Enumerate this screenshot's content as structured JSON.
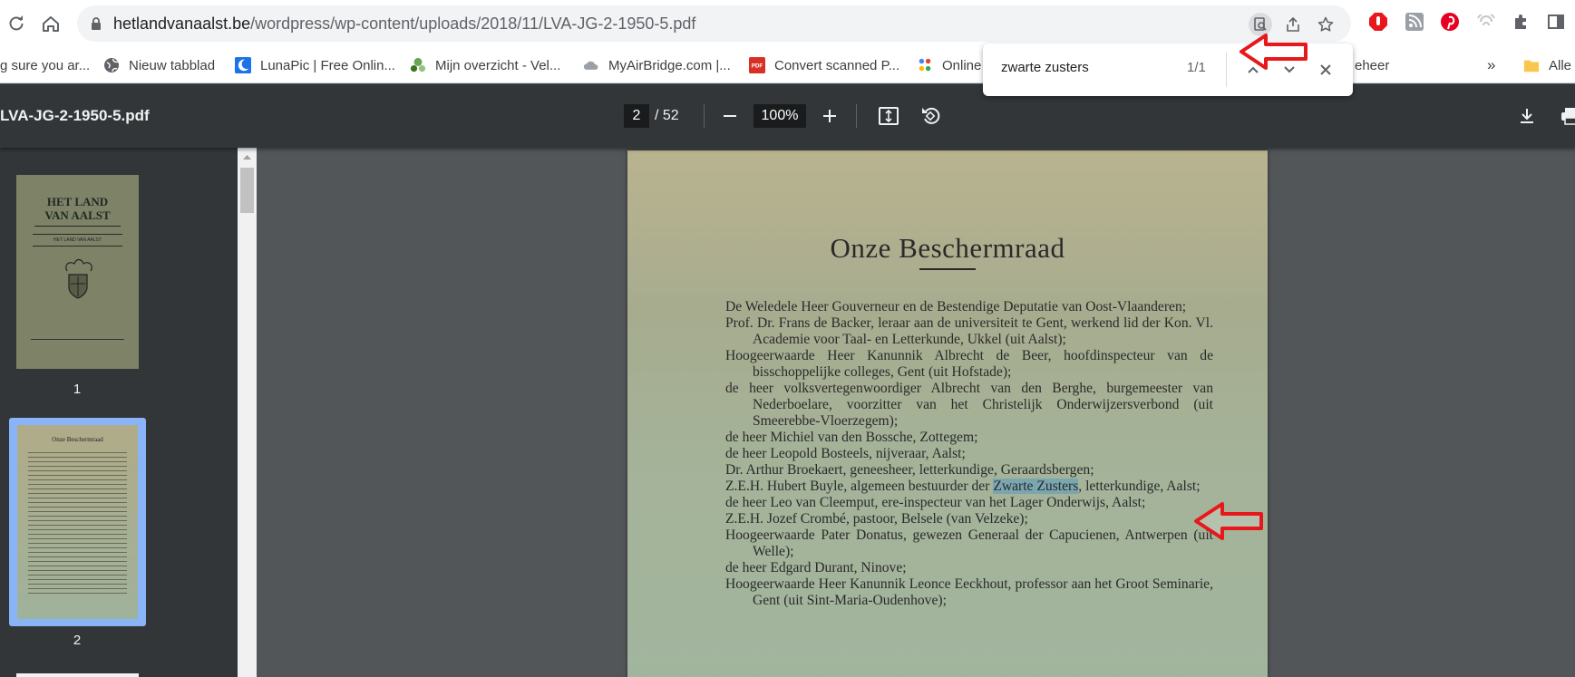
{
  "browser": {
    "url_host": "hetlandvanaalst.be",
    "url_path": "/wordpress/wp-content/uploads/2018/11/LVA-JG-2-1950-5.pdf"
  },
  "bookmarks": [
    {
      "label": "g sure you ar...",
      "icon": "page-icon"
    },
    {
      "label": "Nieuw tabblad",
      "icon": "globe-icon"
    },
    {
      "label": "LunaPic | Free Onlin...",
      "icon": "lunapic-icon"
    },
    {
      "label": "Mijn overzicht - Vel...",
      "icon": "velo-icon"
    },
    {
      "label": "MyAirBridge.com |...",
      "icon": "cloud-icon"
    },
    {
      "label": "Convert scanned P...",
      "icon": "pdf-icon"
    },
    {
      "label": "Online",
      "icon": "dots-icon"
    },
    {
      "label": "eheer",
      "icon": ""
    },
    {
      "label": "Alle",
      "icon": "folder-icon"
    }
  ],
  "bookmarks_overflow": "»",
  "find": {
    "query": "zwarte zusters",
    "count": "1/1"
  },
  "pdf": {
    "filename": "LVA-JG-2-1950-5.pdf",
    "page_current": "2",
    "page_total": "/ 52",
    "zoom": "100%"
  },
  "thumbnails": [
    {
      "number": "1",
      "title_line1": "HET LAND",
      "title_line2": "VAN AALST",
      "banner": "HET LAND VAN AALST"
    },
    {
      "number": "2",
      "title": "Onze Beschermraad"
    }
  ],
  "document": {
    "title": "Onze Beschermraad",
    "entries": [
      [
        "De Weledele Heer Gouverneur en de Bestendige Deputatie van Oost-Vlaanderen;"
      ],
      [
        "Prof. Dr. Frans de Backer, leraar aan de universiteit te Gent, werkend lid der Kon. Vl. Academie voor Taal- en Letterkunde, Ukkel (uit Aalst);"
      ],
      [
        "Hoogeerwaarde Heer Kanunnik Albrecht de Beer, hoofdinspecteur van de bisschoppelijke colleges, Gent (uit Hofstade);"
      ],
      [
        "de heer volksvertegenwoordiger Albrecht van den Berghe, burgemeester van Nederboelare, voorzitter van het Christelijk Onderwijzersverbond (uit Smeerebbe-Vloerzegem);"
      ],
      [
        "de heer Michiel van den Bossche, Zottegem;"
      ],
      [
        "de heer Leopold Bosteels, nijveraar, Aalst;"
      ],
      [
        "Dr. Arthur Broekaert, geneesheer, letterkundige, Geraardsbergen;"
      ],
      [
        "Z.E.H. Hubert Buyle, algemeen bestuurder der ",
        "Zwarte Zusters",
        ", letterkundige, Aalst;"
      ],
      [
        "de heer Leo van Cleemput, ere-inspecteur van het Lager Onderwijs, Aalst;"
      ],
      [
        "Z.E.H. Jozef Crombé, pastoor, Belsele (van Velzeke);"
      ],
      [
        "Hoogeerwaarde Pater Donatus, gewezen Generaal der Capucienen, Antwerpen (uit Welle);"
      ],
      [
        "de heer Edgard Durant, Ninove;"
      ],
      [
        "Hoogeerwaarde Heer Kanunnik Leonce Eeckhout, professor aan het Groot Seminarie, Gent (uit Sint-Maria-Oudenhove);"
      ]
    ]
  },
  "colors": {
    "annotation_red": "#e8171c",
    "highlight": "#7aa6b0",
    "viewer_bg": "#525659",
    "toolbar_bg": "#323639"
  }
}
